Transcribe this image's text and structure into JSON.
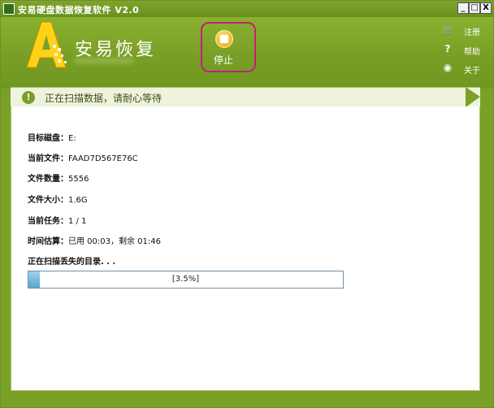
{
  "titlebar": {
    "title": "安易硬盘数据恢复软件 V2.0",
    "btn_min": "_",
    "btn_max": "□",
    "btn_close": "X"
  },
  "header": {
    "brand": "安易恢复",
    "stop_label": "停止",
    "menu": [
      {
        "label": "注册",
        "icon": "cart-icon"
      },
      {
        "label": "帮助",
        "icon": "question-icon"
      },
      {
        "label": "关于",
        "icon": "about-icon"
      }
    ]
  },
  "status": {
    "text": "正在扫描数据，请耐心等待"
  },
  "info": {
    "disk_label": "目标磁盘",
    "disk_value": "E:",
    "file_label": "当前文件",
    "file_value": "FAAD7D567E76C",
    "count_label": "文件数量",
    "count_value": "5556",
    "size_label": "文件大小",
    "size_value": "1.6G",
    "task_label": "当前任务",
    "task_value": "1 / 1",
    "time_label": "时间估算",
    "time_value": "已用 00:03，剩余 01:46",
    "scan_text": "正在扫描丢失的目录. . ."
  },
  "progress": {
    "value_percent": 3.5,
    "label": "[3.5%]"
  },
  "colors": {
    "accent": "#7aa027",
    "highlight": "#c0207a",
    "progress": "#5aa6cf"
  }
}
